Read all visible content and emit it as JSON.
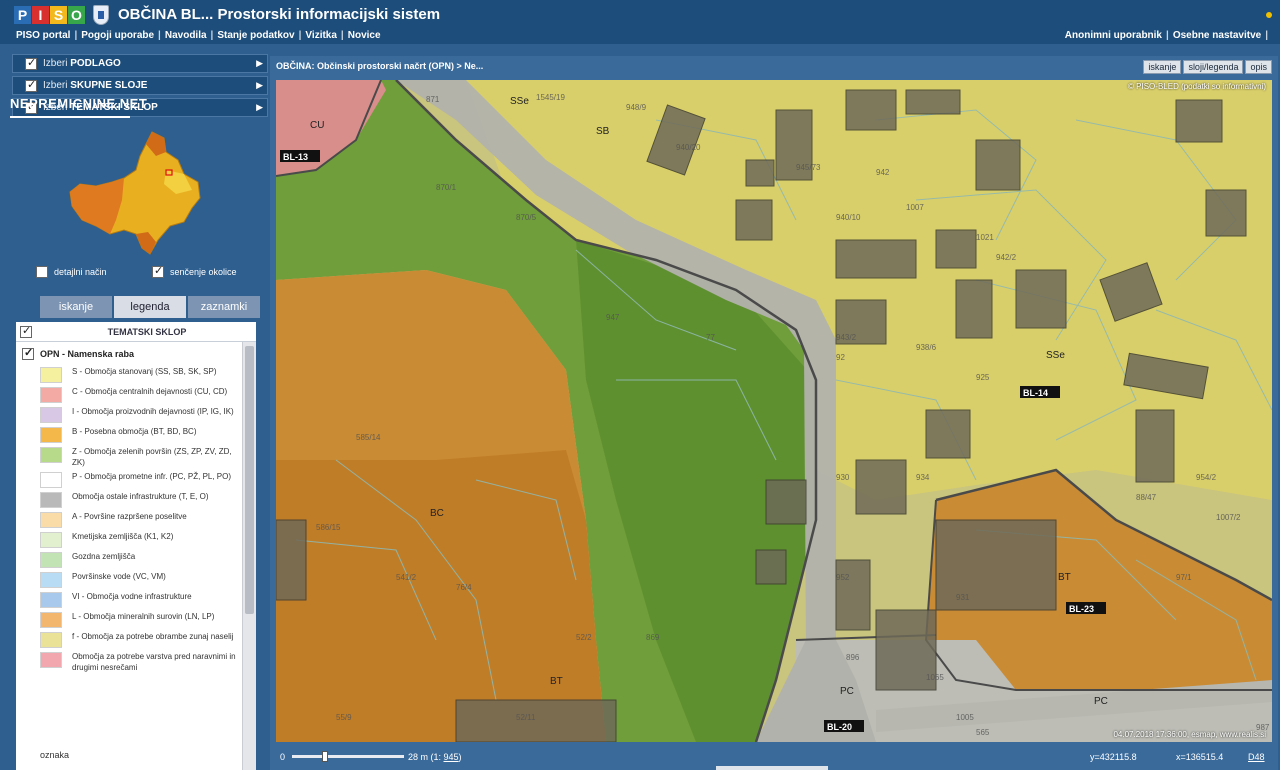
{
  "header": {
    "logo_letters": [
      "P",
      "I",
      "S",
      "O"
    ],
    "logo_colors": [
      "#2a6db5",
      "#d8302f",
      "#f2b81c",
      "#37a54a"
    ],
    "title": "OBČINA BL... Prostorski informacijski sistem"
  },
  "menu": {
    "left": [
      "PISO portal",
      "Pogoji uporabe",
      "Navodila",
      "Stanje podatkov",
      "Vizitka",
      "Novice"
    ],
    "right": [
      "Anonimni uporabnik",
      "Osebne nastavitve"
    ]
  },
  "layers": [
    {
      "prefix": "Izberi",
      "name": "PODLAGO"
    },
    {
      "prefix": "Izberi",
      "name": "SKUPNE SLOJE"
    },
    {
      "prefix": "Izberi",
      "name": "TEMATSKI SKLOP"
    }
  ],
  "watermark": "NEPREMICNINE.NET",
  "options": {
    "detail": "detajlni način",
    "shading": "senčenje okolice"
  },
  "tabs": [
    "iskanje",
    "legenda",
    "zaznamki"
  ],
  "legend": {
    "header": "TEMATSKI SKLOP",
    "group": "OPN - Namenska raba",
    "items": [
      {
        "label": "S - Območja stanovanj (SS, SB, SK, SP)",
        "color": "#f5f0a0"
      },
      {
        "label": "C - Območja centralnih dejavnosti (CU, CD)",
        "color": "#f4aaa4"
      },
      {
        "label": "I - Območja proizvodnih dejavnosti (IP, IG, IK)",
        "color": "#d9c7e6"
      },
      {
        "label": "B - Posebna območja (BT, BD, BC)",
        "color": "#f4b84a"
      },
      {
        "label": "Z - Območja zelenih površin (ZS, ZP, ZV, ZD, ZK)",
        "color": "#b7d98a"
      },
      {
        "label": "P - Območja prometne infr. (PC, PŽ, PL, PO)",
        "color": "#ffffff"
      },
      {
        "label": "Območja ostale infrastrukture (T, E, O)",
        "color": "#b9b9b9"
      },
      {
        "label": "A - Površine razpršene poselitve",
        "color": "#f9dca8"
      },
      {
        "label": "Kmetijska zemljišča (K1, K2)",
        "color": "#e3f0cf"
      },
      {
        "label": "Gozdna zemljišča",
        "color": "#c2e3b4"
      },
      {
        "label": "Površinske vode (VC, VM)",
        "color": "#b7dcf3"
      },
      {
        "label": "VI - Območja vodne infrastrukture",
        "color": "#a8c8ec"
      },
      {
        "label": "L - Območja mineralnih surovin (LN, LP)",
        "color": "#f2b66f"
      },
      {
        "label": "f - Območja za potrebe obrambe zunaj naselij",
        "color": "#eae397"
      },
      {
        "label": "Območja za potrebe varstva pred naravnimi in drugimi nesrečami",
        "color": "#f1a7ad"
      }
    ],
    "footer": "oznaka"
  },
  "map": {
    "breadcrumb": "OBČINA: Občinski prostorski načrt (OPN) > Ne...",
    "tools": [
      "iskanje",
      "sloji/legenda",
      "opis"
    ],
    "copyright": "© PISO-BLED (podatki so informativni)",
    "stamp": "04.07.2018 17:36:00, esmap, www.realis.si",
    "zone_labels": [
      "SSe",
      "SB",
      "CU",
      "BC",
      "BT",
      "SSe",
      "BT",
      "PC",
      "PC"
    ],
    "block_labels": [
      "BL-13",
      "BL-14",
      "BL-23",
      "BL-20"
    ],
    "parcel_numbers": [
      "871",
      "1545/19",
      "948/9",
      "870/1",
      "870/5",
      "940/20",
      "945/73",
      "942",
      "947",
      "940/10",
      "1007",
      "1021",
      "942/2",
      "943/2",
      "938/6",
      "925",
      "934",
      "930",
      "931",
      "952",
      "92",
      "77",
      "585/14",
      "586/15",
      "541/2",
      "76/4",
      "55/9",
      "52/2",
      "52/11",
      "869",
      "896",
      "1065",
      "565",
      "987",
      "1005",
      "88/47",
      "954/2",
      "1007/2",
      "97/1"
    ]
  },
  "status": {
    "zero": "0",
    "scale": "28 m (1: ",
    "scale_link": "945",
    "scale_close": ")",
    "coord_y": "y=432115.8",
    "coord_x": "x=136515.4",
    "coord_sys": "D48"
  }
}
